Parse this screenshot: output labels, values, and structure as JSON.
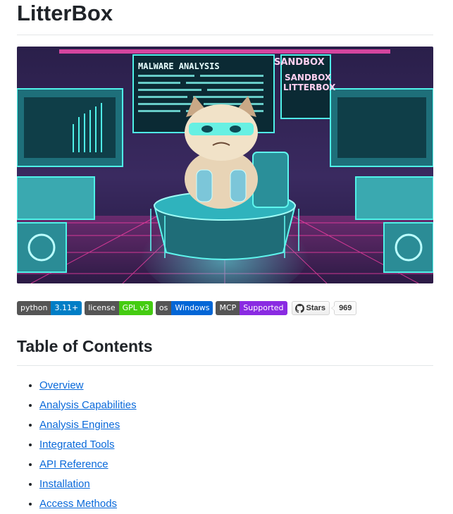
{
  "title": "LitterBox",
  "banner": {
    "label_left": "MALWARE ANALYSIS",
    "label_right_1": "SANDBOX",
    "label_right_2": "SANDBOX",
    "label_right_3": "LITTERBOX"
  },
  "badges": [
    {
      "left": "python",
      "right": "3.11+",
      "color": "#007ec6"
    },
    {
      "left": "license",
      "right": "GPL v3",
      "color": "#4c1"
    },
    {
      "left": "os",
      "right": "Windows",
      "color": "#0366d6"
    },
    {
      "left": "MCP",
      "right": "Supported",
      "color": "#8a2be2"
    }
  ],
  "github_stars": {
    "label": "Stars",
    "count": "969"
  },
  "toc_heading": "Table of Contents",
  "toc": [
    "Overview",
    "Analysis Capabilities",
    "Analysis Engines",
    "Integrated Tools",
    "API Reference",
    "Installation",
    "Access Methods"
  ]
}
